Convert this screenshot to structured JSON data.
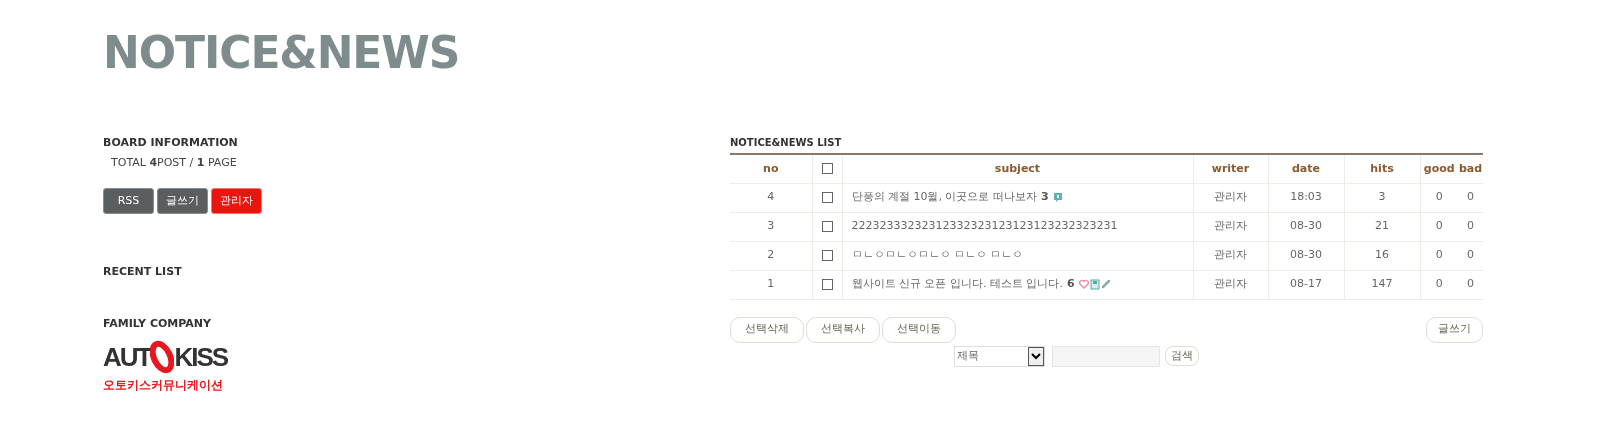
{
  "page_title": "NOTICE&NEWS",
  "board_info": {
    "heading": "BOARD INFORMATION",
    "total": "TOTAL **4**POST / **1** PAGE",
    "buttons": [
      {
        "label": "RSS",
        "kind": "dark"
      },
      {
        "label": "글쓰기",
        "kind": "dark"
      },
      {
        "label": "관리자",
        "kind": "red"
      }
    ]
  },
  "recent_list": {
    "heading": "RECENT LIST"
  },
  "family_company": {
    "heading": "FAMILY COMPANY",
    "logo": {
      "left": "AUT",
      "right": "KISS",
      "caption": "오토키스커뮤니케이션"
    }
  },
  "list": {
    "heading": "NOTICE&NEWS LIST",
    "columns": [
      {
        "label": "no",
        "kind": "text"
      },
      {
        "kind": "checkbox",
        "checked": false
      },
      {
        "label": "subject",
        "kind": "text"
      },
      {
        "label": "writer",
        "kind": "text"
      },
      {
        "label": "date",
        "kind": "text"
      },
      {
        "label": "hits",
        "kind": "text"
      },
      {
        "label": "good",
        "kind": "text"
      },
      {
        "label": "bad",
        "kind": "text"
      }
    ],
    "rows": [
      {
        "no": "4",
        "checked": false,
        "subject": "단풍의 계절 10월, 이곳으로 떠나보자",
        "comments": "3",
        "badges": [
          {
            "kind": "comment"
          }
        ],
        "writer": "관리자",
        "date": "18:03",
        "hits": "3",
        "good": "0",
        "bad": "0"
      },
      {
        "no": "3",
        "checked": false,
        "subject": "22232333232312332323123123123232323231",
        "badges": [],
        "writer": "관리자",
        "date": "08-30",
        "hits": "21",
        "good": "0",
        "bad": "0"
      },
      {
        "no": "2",
        "checked": false,
        "subject": "ㅁㄴㅇㅁㄴㅇㅁㄴㅇ ㅁㄴㅇ ㅁㄴㅇ",
        "badges": [],
        "writer": "관리자",
        "date": "08-30",
        "hits": "16",
        "good": "0",
        "bad": "0"
      },
      {
        "no": "1",
        "checked": false,
        "subject": "웹사이트 신규 오픈 입니다. 테스트 입니다.",
        "comments": "6",
        "badges": [
          {
            "kind": "heart"
          },
          {
            "kind": "file"
          },
          {
            "kind": "link"
          }
        ],
        "writer": "관리자",
        "date": "08-17",
        "hits": "147",
        "good": "0",
        "bad": "0"
      }
    ],
    "actions": [
      "선택삭제",
      "선택복사",
      "선택이동"
    ],
    "write_button": "글쓰기",
    "search": {
      "field": "제목",
      "button": "검색"
    }
  }
}
